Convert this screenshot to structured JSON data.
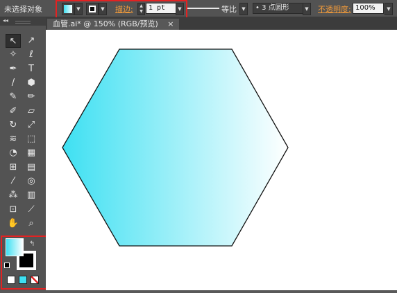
{
  "control_bar": {
    "selection_label": "未选择对象",
    "stroke_label": "描边:",
    "stroke_weight": "1 pt",
    "profile_label": "等比",
    "brush_label": "• 3 点圆形",
    "opacity_label": "不透明度:",
    "opacity_value": "100%"
  },
  "document_tab": {
    "title": "血管.ai* @ 150% (RGB/预览)",
    "close_glyph": "×"
  },
  "panel": {
    "collapse_glyph": "◂◂"
  },
  "colors": {
    "highlight": "#e32222",
    "gradient_start": "#3ee0f2",
    "gradient_end": "#ffffff",
    "canvas": "#ffffff",
    "ui_bg": "#535353"
  },
  "tools": [
    {
      "name": "selection-tool-icon",
      "glyph": "↖"
    },
    {
      "name": "direct-selection-tool-icon",
      "glyph": "↗"
    },
    {
      "name": "magic-wand-tool-icon",
      "glyph": "✧"
    },
    {
      "name": "lasso-tool-icon",
      "glyph": "ℓ"
    },
    {
      "name": "pen-tool-icon",
      "glyph": "✒"
    },
    {
      "name": "type-tool-icon",
      "glyph": "T"
    },
    {
      "name": "line-tool-icon",
      "glyph": "/"
    },
    {
      "name": "polygon-tool-icon",
      "glyph": "⬢"
    },
    {
      "name": "paintbrush-tool-icon",
      "glyph": "✎"
    },
    {
      "name": "pencil-tool-icon",
      "glyph": "✏"
    },
    {
      "name": "blob-brush-tool-icon",
      "glyph": "✐"
    },
    {
      "name": "eraser-tool-icon",
      "glyph": "▱"
    },
    {
      "name": "rotate-tool-icon",
      "glyph": "↻"
    },
    {
      "name": "scale-tool-icon",
      "glyph": "⤢"
    },
    {
      "name": "warp-tool-icon",
      "glyph": "≋"
    },
    {
      "name": "free-transform-tool-icon",
      "glyph": "⬚"
    },
    {
      "name": "shape-builder-tool-icon",
      "glyph": "◔"
    },
    {
      "name": "perspective-grid-tool-icon",
      "glyph": "▦"
    },
    {
      "name": "mesh-tool-icon",
      "glyph": "⊞"
    },
    {
      "name": "gradient-tool-icon",
      "glyph": "▤"
    },
    {
      "name": "eyedropper-tool-icon",
      "glyph": "⁄"
    },
    {
      "name": "blend-tool-icon",
      "glyph": "◎"
    },
    {
      "name": "symbol-sprayer-tool-icon",
      "glyph": "⁂"
    },
    {
      "name": "column-graph-tool-icon",
      "glyph": "▥"
    },
    {
      "name": "artboard-tool-icon",
      "glyph": "⊡"
    },
    {
      "name": "slice-tool-icon",
      "glyph": "⟋"
    },
    {
      "name": "hand-tool-icon",
      "glyph": "✋"
    },
    {
      "name": "zoom-tool-icon",
      "glyph": "⌕"
    }
  ]
}
